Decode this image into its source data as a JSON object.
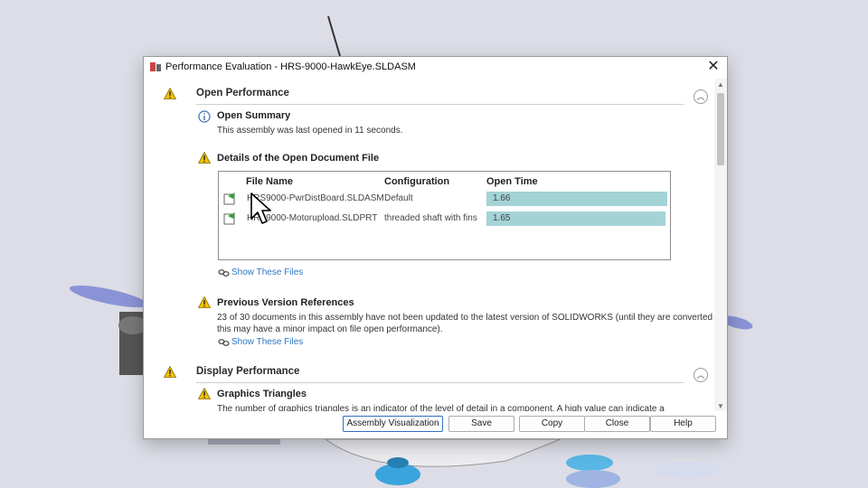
{
  "window": {
    "title": "Performance Evaluation - HRS-9000-HawkEye.SLDASM",
    "close_glyph": "✕"
  },
  "sections": {
    "open_performance": {
      "title": "Open Performance",
      "collapse_glyph": "︿",
      "open_summary": {
        "title": "Open Summary",
        "text": "This assembly was last opened in 11 seconds."
      },
      "details": {
        "title": "Details of the Open Document File",
        "columns": [
          "File Name",
          "Configuration",
          "Open Time"
        ],
        "rows": [
          {
            "file": "HRS9000-PwrDistBoard.SLDASM",
            "config": "Default",
            "time": "1.66"
          },
          {
            "file": "HRS9000-Motorupload.SLDPRT",
            "config": "threaded shaft with fins",
            "time": "1.65"
          }
        ],
        "show_files": "Show These Files"
      },
      "previous_versions": {
        "title": "Previous Version References",
        "line1": "23 of 30 documents in this assembly have not been updated to the latest version of SOLIDWORKS (until they are converted",
        "line2": "this may have a minor impact on file open performance).",
        "show_files": "Show These Files"
      }
    },
    "display_performance": {
      "title": "Display Performance",
      "collapse_glyph": "︿",
      "graphics_triangles": {
        "title": "Graphics Triangles",
        "text": "The number of graphics triangles is an indicator of the level of detail in a component. A high value can indicate a"
      }
    }
  },
  "buttons": {
    "assembly_visualization": "Assembly Visualization",
    "save": "Save",
    "copy": "Copy",
    "close": "Close",
    "help": "Help"
  },
  "colors": {
    "accent": "#2e6fc2",
    "bar": "#a4d3d6",
    "warning": "#f2c200",
    "info": "#3a6fb5"
  }
}
